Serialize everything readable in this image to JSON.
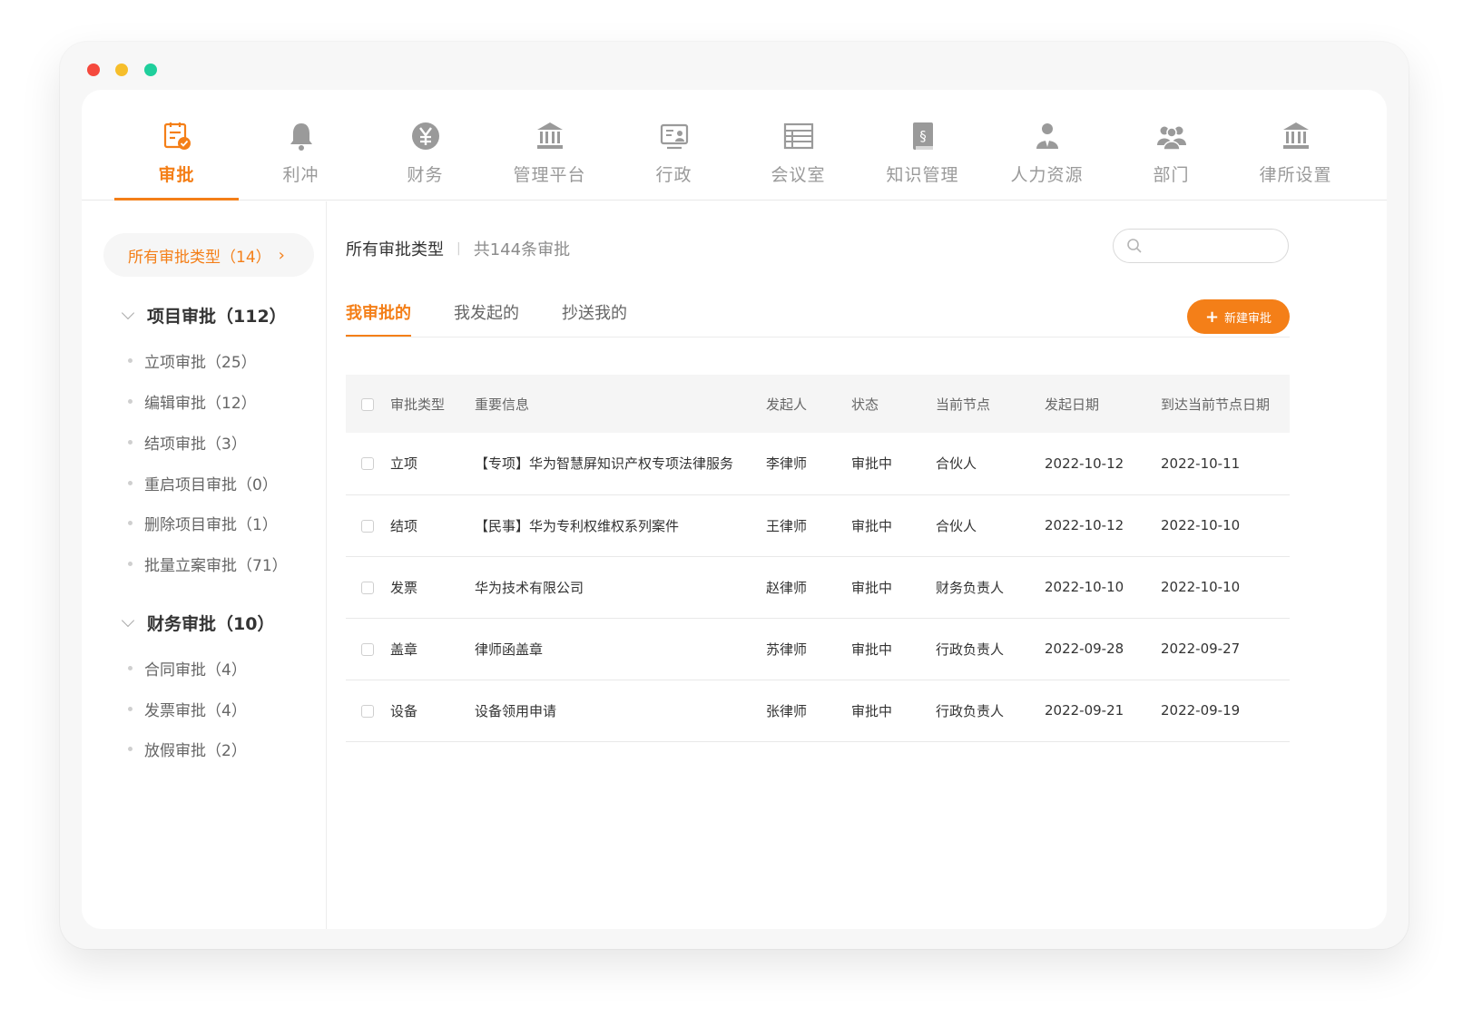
{
  "window": {
    "traffic_lights": {
      "close": "#f5493d",
      "minimize": "#f6be2b",
      "zoom": "#1fcf9c"
    }
  },
  "colors": {
    "accent": "#f47f18",
    "icon_gray": "#9a9a9a"
  },
  "topnav": {
    "items": [
      {
        "label": "审批",
        "icon": "approval-doc-icon",
        "active": true
      },
      {
        "label": "利冲",
        "icon": "bell-icon"
      },
      {
        "label": "财务",
        "icon": "yen-icon"
      },
      {
        "label": "管理平台",
        "icon": "bank-icon"
      },
      {
        "label": "行政",
        "icon": "admin-card-icon"
      },
      {
        "label": "会议室",
        "icon": "table-icon"
      },
      {
        "label": "知识管理",
        "icon": "law-book-icon"
      },
      {
        "label": "人力资源",
        "icon": "person-icon"
      },
      {
        "label": "部门",
        "icon": "group-icon"
      },
      {
        "label": "律所设置",
        "icon": "institution-icon"
      }
    ]
  },
  "sidebar": {
    "all": "所有审批类型（14）",
    "groups": [
      {
        "title": "项目审批（112）",
        "items": [
          "立项审批（25）",
          "编辑审批（12）",
          "结项审批（3）",
          "重启项目审批（0）",
          "删除项目审批（1）",
          "批量立案审批（71）"
        ]
      },
      {
        "title": "财务审批（10）",
        "items": [
          "合同审批（4）",
          "发票审批（4）",
          "放假审批（2）"
        ]
      }
    ]
  },
  "main": {
    "crumb_title": "所有审批类型",
    "crumb_count": "共144条审批",
    "search_placeholder": "",
    "tabs": [
      "我审批的",
      "我发起的",
      "抄送我的"
    ],
    "new_button": "新建审批",
    "table": {
      "headers": [
        "审批类型",
        "重要信息",
        "发起人",
        "状态",
        "当前节点",
        "发起日期",
        "到达当前节点日期"
      ],
      "rows": [
        [
          "立项",
          "【专项】华为智慧屏知识产权专项法律服务",
          "李律师",
          "审批中",
          "合伙人",
          "2022-10-12",
          "2022-10-11"
        ],
        [
          "结项",
          "【民事】华为专利权维权系列案件",
          "王律师",
          "审批中",
          "合伙人",
          "2022-10-12",
          "2022-10-10"
        ],
        [
          "发票",
          "华为技术有限公司",
          "赵律师",
          "审批中",
          "财务负责人",
          "2022-10-10",
          "2022-10-10"
        ],
        [
          "盖章",
          "律师函盖章",
          "苏律师",
          "审批中",
          "行政负责人",
          "2022-09-28",
          "2022-09-27"
        ],
        [
          "设备",
          "设备领用申请",
          "张律师",
          "审批中",
          "行政负责人",
          "2022-09-21",
          "2022-09-19"
        ]
      ]
    }
  }
}
